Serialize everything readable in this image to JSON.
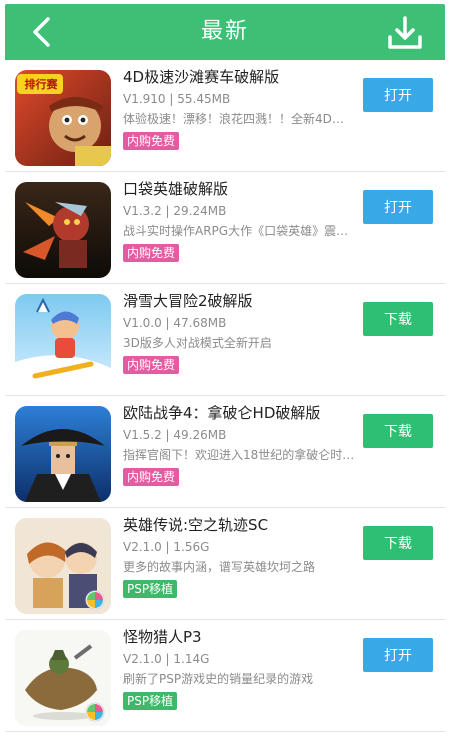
{
  "header": {
    "title": "最新",
    "color": "#3dbf76"
  },
  "actions_colors": {
    "open": "#39a9e6",
    "download": "#2fbf72"
  },
  "tag_colors": {
    "pink": "#e65aa2",
    "green": "#3fb86a"
  },
  "apps": [
    {
      "name": "4D极速沙滩赛车破解版",
      "meta": "V1.910 | 55.45MB",
      "desc": "体验极速！漂移！浪花四溅！！全新4D沙...",
      "tag": "内购免费",
      "tag_color": "pink",
      "action_label": "打开",
      "action_type": "open",
      "icon_name": "beach-racing-game-icon",
      "icon_badge": "排行赛"
    },
    {
      "name": "口袋英雄破解版",
      "meta": "V1.3.2 | 29.24MB",
      "desc": "战斗实时操作ARPG大作《口袋英雄》震撼...",
      "tag": "内购免费",
      "tag_color": "pink",
      "action_label": "打开",
      "action_type": "open",
      "icon_name": "pocket-heroes-game-icon"
    },
    {
      "name": "滑雪大冒险2破解版",
      "meta": "V1.0.0 | 47.68MB",
      "desc": "3D版多人对战模式全新开启",
      "tag": "内购免费",
      "tag_color": "pink",
      "action_label": "下载",
      "action_type": "download",
      "icon_name": "ski-safari-game-icon"
    },
    {
      "name": "欧陆战争4：拿破仑HD破解版",
      "meta": "V1.5.2 | 49.26MB",
      "desc": "指挥官阁下！欢迎进入18世纪的拿破仑时代...",
      "tag": "内购免费",
      "tag_color": "pink",
      "action_label": "下载",
      "action_type": "download",
      "icon_name": "napoleon-game-icon"
    },
    {
      "name": "英雄传说:空之轨迹SC",
      "meta": "V2.1.0 | 1.56G",
      "desc": "更多的故事内涵，谱写英雄坎坷之路",
      "tag": "PSP移植",
      "tag_color": "green",
      "action_label": "下载",
      "action_type": "download",
      "icon_name": "trails-in-the-sky-game-icon"
    },
    {
      "name": "怪物猎人P3",
      "meta": "V2.1.0 | 1.14G",
      "desc": "刷新了PSP游戏史的销量纪录的游戏",
      "tag": "PSP移植",
      "tag_color": "green",
      "action_label": "打开",
      "action_type": "open",
      "icon_name": "monster-hunter-game-icon"
    }
  ]
}
